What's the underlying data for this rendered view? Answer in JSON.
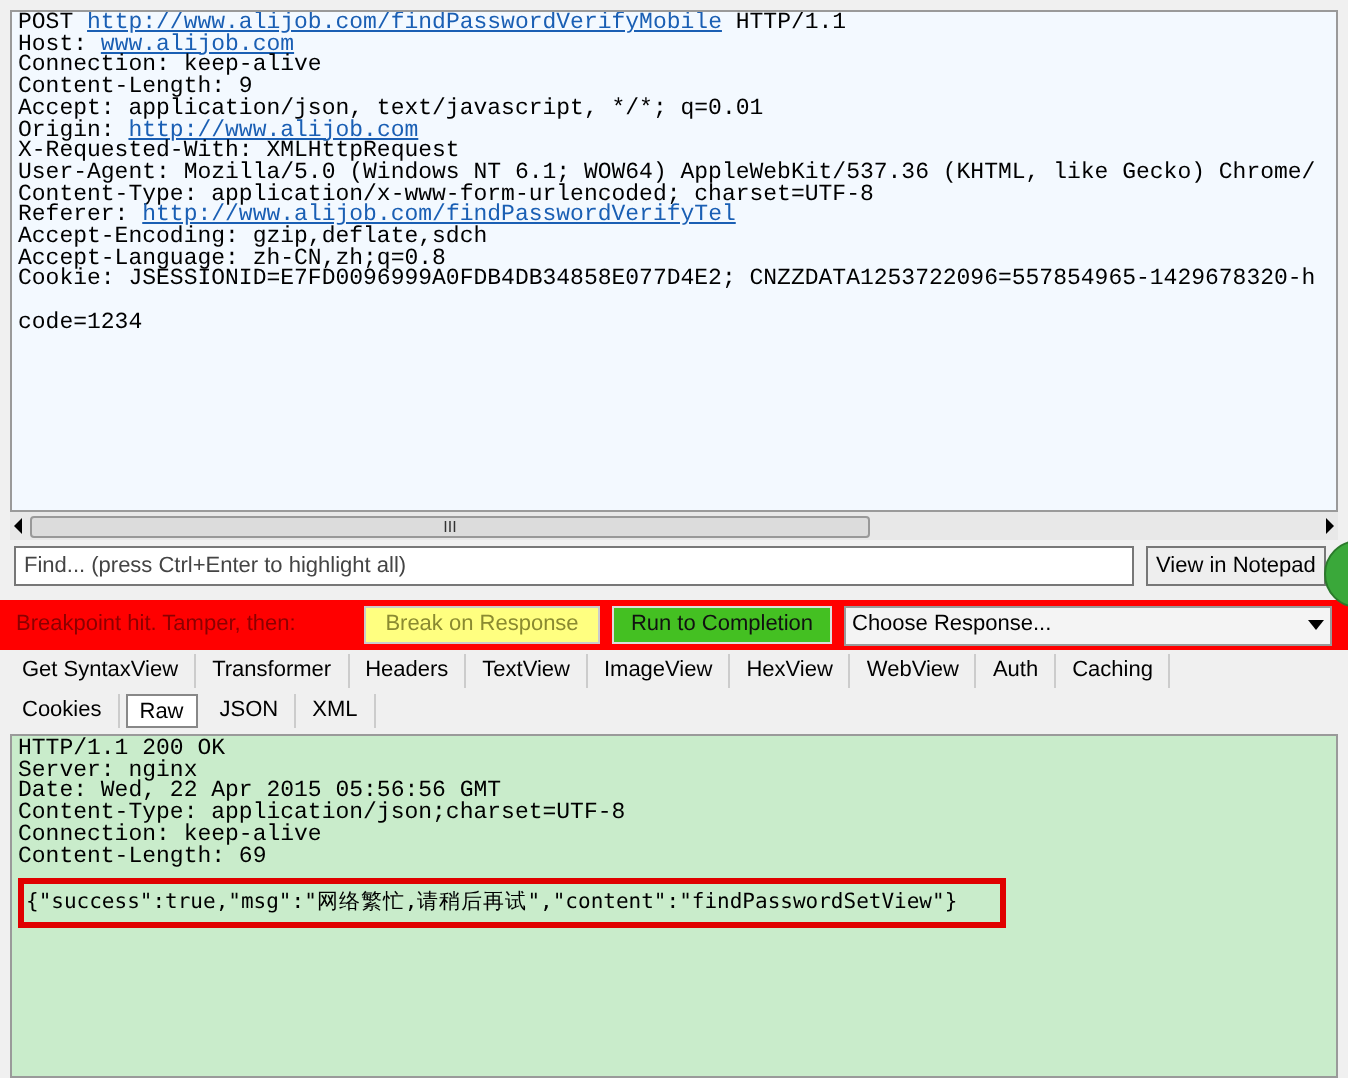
{
  "request": {
    "lines": [
      {
        "text": "POST ",
        "link": "http://www.alijob.com/findPasswordVerifyMobile",
        "after": " HTTP/1.1"
      },
      {
        "text": "Host: ",
        "link": "www.alijob.com"
      },
      {
        "text": "Connection: keep-alive"
      },
      {
        "text": "Content-Length: 9"
      },
      {
        "text": "Accept: application/json, text/javascript, */*; q=0.01"
      },
      {
        "text": "Origin: ",
        "link": "http://www.alijob.com"
      },
      {
        "text": "X-Requested-With: XMLHttpRequest"
      },
      {
        "text": "User-Agent: Mozilla/5.0 (Windows NT 6.1; WOW64) AppleWebKit/537.36 (KHTML, like Gecko) Chrome/"
      },
      {
        "text": "Content-Type: application/x-www-form-urlencoded; charset=UTF-8"
      },
      {
        "text": "Referer: ",
        "link": "http://www.alijob.com/findPasswordVerifyTel"
      },
      {
        "text": "Accept-Encoding: gzip,deflate,sdch"
      },
      {
        "text": "Accept-Language: zh-CN,zh;q=0.8"
      },
      {
        "text": "Cookie: JSESSIONID=E7FD0096999A0FDB4DB34858E077D4E2; CNZZDATA1253722096=557854965-1429678320-h"
      }
    ],
    "body": "code=1234",
    "scrollbar_grip": "III"
  },
  "find": {
    "placeholder": "Find... (press Ctrl+Enter to highlight all)",
    "button": "View in Notepad"
  },
  "breakpoint": {
    "label": "Breakpoint hit. Tamper, then:",
    "break_button": "Break on Response",
    "run_button": "Run to Completion",
    "choose": "Choose Response..."
  },
  "tab_rows": [
    [
      {
        "label": "Get SyntaxView",
        "selected": false
      },
      {
        "label": "Transformer",
        "selected": false
      },
      {
        "label": "Headers",
        "selected": false
      },
      {
        "label": "TextView",
        "selected": false
      },
      {
        "label": "ImageView",
        "selected": false
      },
      {
        "label": "HexView",
        "selected": false
      },
      {
        "label": "WebView",
        "selected": false
      },
      {
        "label": "Auth",
        "selected": false
      },
      {
        "label": "Caching",
        "selected": false
      }
    ],
    [
      {
        "label": "Cookies",
        "selected": false
      },
      {
        "label": "Raw",
        "selected": true
      },
      {
        "label": "JSON",
        "selected": false
      },
      {
        "label": "XML",
        "selected": false
      }
    ]
  ],
  "response": {
    "lines": [
      "HTTP/1.1 200 OK",
      "Server: nginx",
      "Date: Wed, 22 Apr 2015 05:56:56 GMT",
      "Content-Type: application/json;charset=UTF-8",
      "Connection: keep-alive",
      "Content-Length: 69"
    ],
    "body": "{\"success\":true,\"msg\":\"网络繁忙,请稍后再试\",\"content\":\"findPasswordSetView\"}"
  }
}
